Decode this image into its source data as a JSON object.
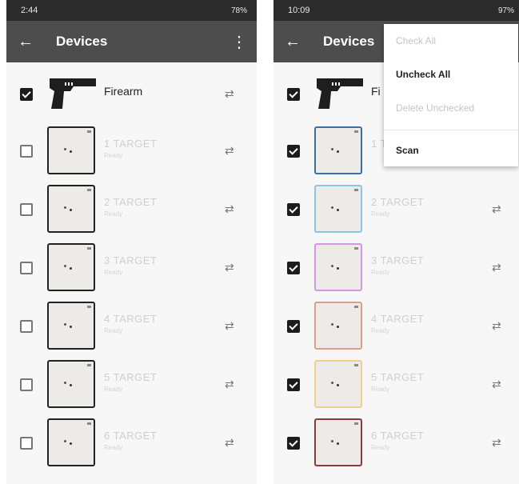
{
  "left": {
    "status_bar": {
      "time": "2:44",
      "right": "78%"
    },
    "app_bar": {
      "title": "Devices"
    },
    "firearm": {
      "name": "Firearm",
      "checked": true
    },
    "targets": [
      {
        "name": "1 TARGET",
        "status": "Ready",
        "checked": false,
        "border": "#222222"
      },
      {
        "name": "2 TARGET",
        "status": "Ready",
        "checked": false,
        "border": "#222222"
      },
      {
        "name": "3 TARGET",
        "status": "Ready",
        "checked": false,
        "border": "#222222"
      },
      {
        "name": "4 TARGET",
        "status": "Ready",
        "checked": false,
        "border": "#222222"
      },
      {
        "name": "5 TARGET",
        "status": "Ready",
        "checked": false,
        "border": "#222222"
      },
      {
        "name": "6 TARGET",
        "status": "Ready",
        "checked": false,
        "border": "#222222"
      }
    ]
  },
  "right": {
    "status_bar": {
      "time": "10:09",
      "right": "97%"
    },
    "app_bar": {
      "title": "Devices"
    },
    "firearm": {
      "name": "Fi",
      "checked": true
    },
    "targets": [
      {
        "name": "1 T",
        "status": "",
        "checked": true,
        "border": "#3b6fa3"
      },
      {
        "name": "2 TARGET",
        "status": "Ready",
        "checked": true,
        "border": "#8cc4e8"
      },
      {
        "name": "3 TARGET",
        "status": "Ready",
        "checked": true,
        "border": "#d596e8"
      },
      {
        "name": "4 TARGET",
        "status": "Ready",
        "checked": true,
        "border": "#e69a8c"
      },
      {
        "name": "5 TARGET",
        "status": "Ready",
        "checked": true,
        "border": "#f2cf8c"
      },
      {
        "name": "6 TARGET",
        "status": "Ready",
        "checked": true,
        "border": "#8f3a3a"
      }
    ],
    "menu": {
      "items": [
        {
          "label": "Check All",
          "enabled": false
        },
        {
          "label": "Uncheck All",
          "enabled": true
        },
        {
          "label": "Delete Unchecked",
          "enabled": false
        },
        {
          "label": "Scan",
          "enabled": true
        }
      ]
    }
  },
  "icons": {
    "back": "arrow-left-icon",
    "overflow": "more-vert-icon",
    "connect": "swap-horiz-icon",
    "firearm": "pistol-icon"
  }
}
